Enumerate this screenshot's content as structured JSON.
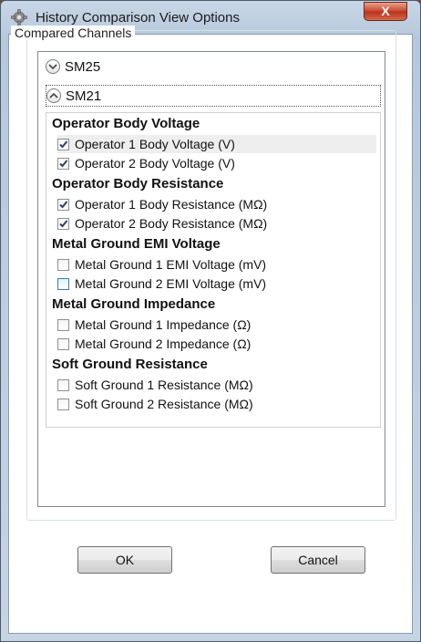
{
  "window": {
    "title": "History Comparison View Options",
    "title_icon": "gear-icon",
    "close_label": "X"
  },
  "group": {
    "label": "Compared Channels"
  },
  "channels": [
    {
      "name": "SM25",
      "expanded": false,
      "icon": "chevron-down-icon"
    },
    {
      "name": "SM21",
      "expanded": true,
      "icon": "chevron-up-icon"
    }
  ],
  "sm21_groups": [
    {
      "heading": "Operator Body Voltage",
      "items": [
        {
          "label": "Operator 1 Body Voltage (V)",
          "checked": true
        },
        {
          "label": "Operator 2 Body Voltage (V)",
          "checked": true
        }
      ]
    },
    {
      "heading": "Operator Body Resistance",
      "items": [
        {
          "label": "Operator 1 Body Resistance (MΩ)",
          "checked": true
        },
        {
          "label": "Operator 2 Body Resistance (MΩ)",
          "checked": true
        }
      ]
    },
    {
      "heading": "Metal Ground EMI Voltage",
      "items": [
        {
          "label": "Metal Ground 1 EMI Voltage (mV)",
          "checked": false
        },
        {
          "label": "Metal Ground 2 EMI Voltage (mV)",
          "checked": false
        }
      ]
    },
    {
      "heading": "Metal Ground Impedance",
      "items": [
        {
          "label": "Metal Ground 1 Impedance (Ω)",
          "checked": false
        },
        {
          "label": "Metal Ground 2 Impedance (Ω)",
          "checked": false
        }
      ]
    },
    {
      "heading": "Soft Ground Resistance",
      "items": [
        {
          "label": "Soft Ground 1 Resistance (MΩ)",
          "checked": false
        },
        {
          "label": "Soft Ground 2 Resistance (MΩ)",
          "checked": false
        }
      ]
    }
  ],
  "buttons": {
    "ok_label": "OK",
    "cancel_label": "Cancel"
  },
  "colors": {
    "checkmark": "#2a3f6b",
    "hot_border": "#3c7fb1"
  }
}
